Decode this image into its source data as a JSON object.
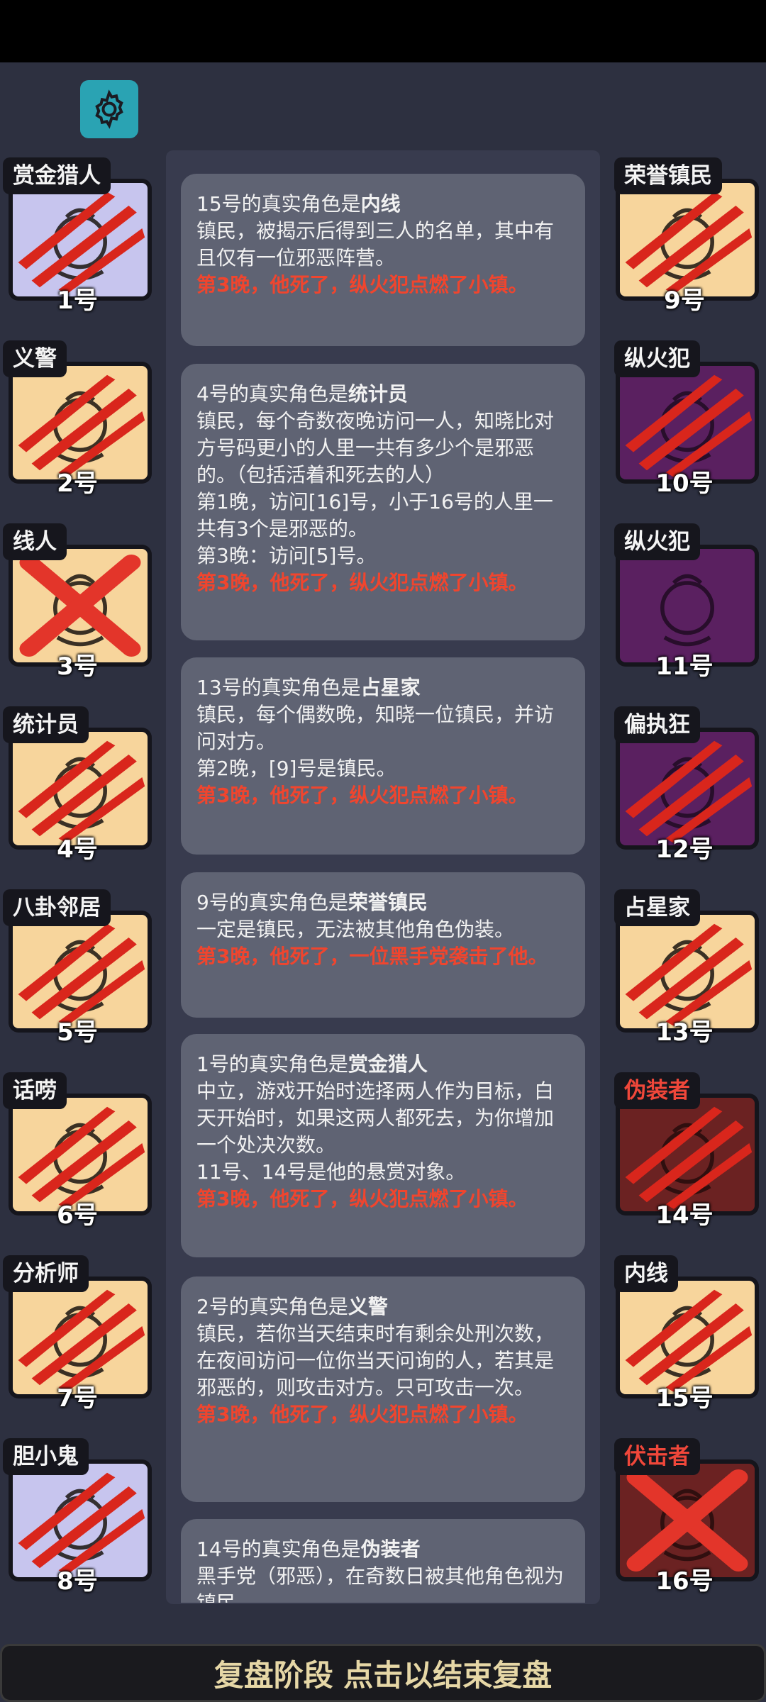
{
  "colors": {
    "background": "#2d3040",
    "card": "#5f6373",
    "death_text": "#f0452e",
    "evil_role": "#f0473a",
    "portrait_villager": "#f7d59c",
    "portrait_outsider": "#c7c5ee",
    "portrait_minion": "#5a2060",
    "portrait_demon": "#6b2222",
    "settings_button": "#2aa3b3"
  },
  "settings": {
    "icon": "gear-icon"
  },
  "left_players": [
    {
      "role": "赏金猎人",
      "seat": "1号",
      "color": "outsider",
      "icon": "money-bag-icon",
      "mark": "claw"
    },
    {
      "role": "义警",
      "seat": "2号",
      "color": "villager",
      "icon": "megaphone-icon",
      "mark": "claw"
    },
    {
      "role": "线人",
      "seat": "3号",
      "color": "villager",
      "icon": "camera-icon",
      "mark": "cross"
    },
    {
      "role": "统计员",
      "seat": "4号",
      "color": "villager",
      "icon": "abacus-icon",
      "mark": "claw"
    },
    {
      "role": "八卦邻居",
      "seat": "5号",
      "color": "villager",
      "icon": "ear-icon",
      "mark": "claw"
    },
    {
      "role": "话唠",
      "seat": "6号",
      "color": "villager",
      "icon": "speech-icon",
      "mark": "claw"
    },
    {
      "role": "分析师",
      "seat": "7号",
      "color": "villager",
      "icon": "book-icon",
      "mark": "claw"
    },
    {
      "role": "胆小鬼",
      "seat": "8号",
      "color": "outsider",
      "icon": "scared-icon",
      "mark": "claw"
    }
  ],
  "right_players": [
    {
      "role": "荣誉镇民",
      "seat": "9号",
      "color": "villager",
      "icon": "medal-icon",
      "mark": "claw",
      "evil": false
    },
    {
      "role": "纵火犯",
      "seat": "10号",
      "color": "minion",
      "icon": "torch-icon",
      "mark": "claw",
      "evil": false
    },
    {
      "role": "纵火犯",
      "seat": "11号",
      "color": "minion",
      "icon": "torch-icon",
      "mark": "none",
      "evil": false
    },
    {
      "role": "偏执狂",
      "seat": "12号",
      "color": "minion",
      "icon": "brain-icon",
      "mark": "claw",
      "evil": false
    },
    {
      "role": "占星家",
      "seat": "13号",
      "color": "villager",
      "icon": "telescope-icon",
      "mark": "claw",
      "evil": false
    },
    {
      "role": "伪装者",
      "seat": "14号",
      "color": "demon",
      "icon": "mask-icon",
      "mark": "claw",
      "evil": true
    },
    {
      "role": "内线",
      "seat": "15号",
      "color": "villager",
      "icon": "envelope-icon",
      "mark": "claw",
      "evil": false
    },
    {
      "role": "伏击者",
      "seat": "16号",
      "color": "demon",
      "icon": "door-icon",
      "mark": "cross",
      "evil": true
    }
  ],
  "log": [
    {
      "prefix": "15号的真实角色是",
      "role": "内线",
      "body": [
        "镇民，被揭示后得到三人的名单，其中有且仅有一位邪恶阵营。"
      ],
      "death": "第3晚，他死了，纵火犯点燃了小镇。"
    },
    {
      "prefix": "4号的真实角色是",
      "role": "统计员",
      "body": [
        "镇民，每个奇数夜晚访问一人，知晓比对方号码更小的人里一共有多少个是邪恶的。（包括活着和死去的人）",
        "第1晚，访问[16]号，小于16号的人里一共有3个是邪恶的。",
        "第3晚：访问[5]号。"
      ],
      "death": "第3晚，他死了，纵火犯点燃了小镇。"
    },
    {
      "prefix": "13号的真实角色是",
      "role": "占星家",
      "body": [
        "镇民，每个偶数晚，知晓一位镇民，并访问对方。",
        "第2晚，[9]号是镇民。"
      ],
      "death": "第3晚，他死了，纵火犯点燃了小镇。"
    },
    {
      "prefix": "9号的真实角色是",
      "role": "荣誉镇民",
      "body": [
        "一定是镇民，无法被其他角色伪装。"
      ],
      "death": "第3晚，他死了，一位黑手党袭击了他。"
    },
    {
      "prefix": "1号的真实角色是",
      "role": "赏金猎人",
      "body": [
        "中立，游戏开始时选择两人作为目标，白天开始时，如果这两人都死去，为你增加一个处决次数。",
        "11号、14号是他的悬赏对象。"
      ],
      "death": "第3晚，他死了，纵火犯点燃了小镇。"
    },
    {
      "prefix": "2号的真实角色是",
      "role": "义警",
      "body": [
        "镇民，若你当天结束时有剩余处刑次数，在夜间访问一位你当天问询的人，若其是邪恶的，则攻击对方。只可攻击一次。"
      ],
      "death": "第3晚，他死了，纵火犯点燃了小镇。"
    },
    {
      "prefix": "14号的真实角色是",
      "role": "伪装者",
      "body": [
        "黑手党（邪恶），在奇数日被其他角色视为镇民"
      ],
      "death": ""
    }
  ],
  "bottom": {
    "label": "复盘阶段 点击以结束复盘"
  }
}
